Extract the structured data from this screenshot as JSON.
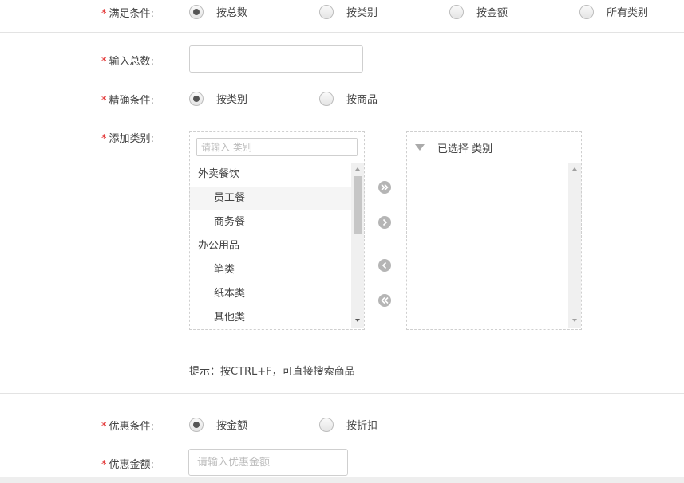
{
  "satisfy": {
    "label": "满足条件:",
    "options": [
      "按总数",
      "按类别",
      "按金额",
      "所有类别"
    ],
    "selected_index": 0
  },
  "total": {
    "label": "输入总数:",
    "value": ""
  },
  "precise": {
    "label": "精确条件:",
    "options": [
      "按类别",
      "按商品"
    ],
    "selected_index": 0
  },
  "category": {
    "label": "添加类别:",
    "search_placeholder": "请输入 类别",
    "tree": [
      {
        "label": "外卖餐饮",
        "level": 0
      },
      {
        "label": "员工餐",
        "level": 1
      },
      {
        "label": "商务餐",
        "level": 1
      },
      {
        "label": "办公用品",
        "level": 0
      },
      {
        "label": "笔类",
        "level": 1
      },
      {
        "label": "纸本类",
        "level": 1
      },
      {
        "label": "其他类",
        "level": 1
      }
    ],
    "selected_header": "已选择 类别",
    "hint": "提示：按CTRL+F，可直接搜索商品"
  },
  "discount": {
    "label": "优惠条件:",
    "options": [
      "按金额",
      "按折扣"
    ],
    "selected_index": 0
  },
  "discount_amount": {
    "label": "优惠金额:",
    "placeholder": "请输入优惠金额"
  },
  "colors": {
    "required": "#e02020",
    "text": "#444444",
    "border": "#cfcfcf",
    "button_gray": "#b5b5b5"
  }
}
